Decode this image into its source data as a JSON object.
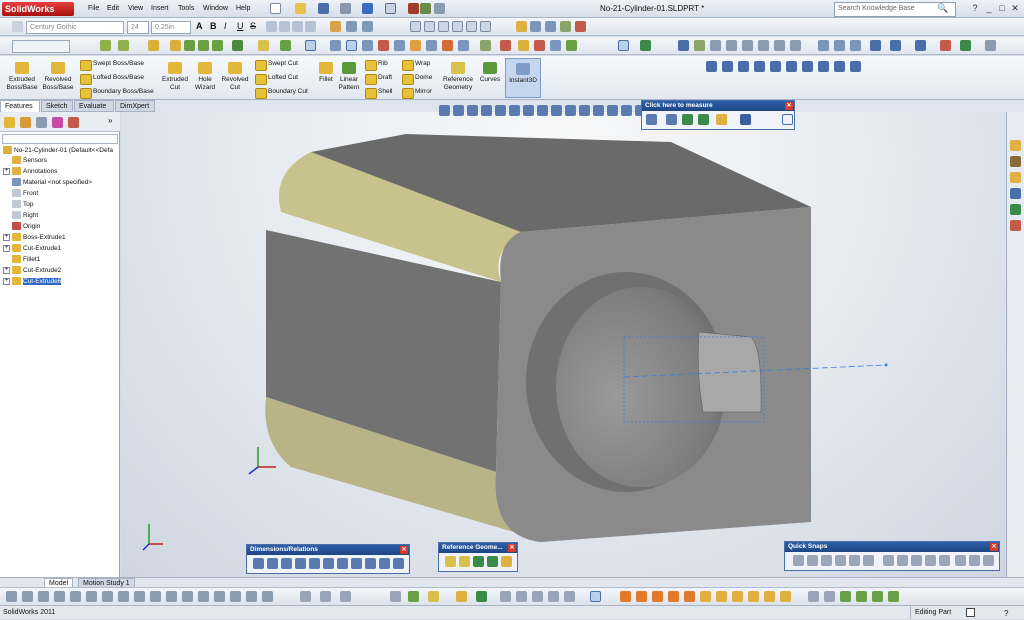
{
  "app": {
    "logo": "SolidWorks",
    "doc_title": "No-21-Cylinder-01.SLDPRT *"
  },
  "menu": [
    "File",
    "Edit",
    "View",
    "Insert",
    "Tools",
    "Window",
    "Help"
  ],
  "search": {
    "placeholder": "Search Knowledge Base"
  },
  "format": {
    "font": "Century Gothic",
    "size": "24",
    "height": "0.25in"
  },
  "features": {
    "extruded_boss": "Extruded Boss/Base",
    "revolved_boss": "Revolved Boss/Base",
    "swept_boss": "Swept Boss/Base",
    "lofted_boss": "Lofted Boss/Base",
    "boundary_boss": "Boundary Boss/Base",
    "extruded_cut": "Extruded Cut",
    "hole_wizard": "Hole Wizard",
    "revolved_cut": "Revolved Cut",
    "swept_cut": "Swept Cut",
    "lofted_cut": "Lofted Cut",
    "boundary_cut": "Boundary Cut",
    "fillet": "Fillet",
    "linear_pattern": "Linear Pattern",
    "rib": "Rib",
    "draft": "Draft",
    "shell": "Shell",
    "wrap": "Wrap",
    "dome": "Dome",
    "mirror": "Mirror",
    "reference_geometry": "Reference Geometry",
    "curves": "Curves",
    "instant3d": "Instant3D"
  },
  "tabs": [
    "Features",
    "Sketch",
    "Evaluate",
    "DimXpert"
  ],
  "tree": {
    "root": "No-21-Cylinder-01  (Default<<Defa",
    "items": [
      "Sensors",
      "Annotations",
      "Material <not specified>",
      "Front",
      "Top",
      "Right",
      "Origin",
      "Boss-Extrude1",
      "Cut-Extrude1",
      "Fillet1",
      "Cut-Extrude2",
      "Cut-Extrude6"
    ]
  },
  "panels": {
    "measure": "Click here to measure",
    "dimensions": "Dimensions/Relations",
    "refgeom": "Reference Geome...",
    "quicksnaps": "Quick Snaps"
  },
  "bottom_tabs": [
    "Model",
    "Motion Study 1"
  ],
  "status": {
    "left": "SolidWorks 2011",
    "mode": "Editing Part"
  },
  "colors": {
    "face_dark": "#6f6f6f",
    "face_light": "#8c8c8c",
    "fillet": "#c8c28c",
    "accent": "#316ac5"
  }
}
